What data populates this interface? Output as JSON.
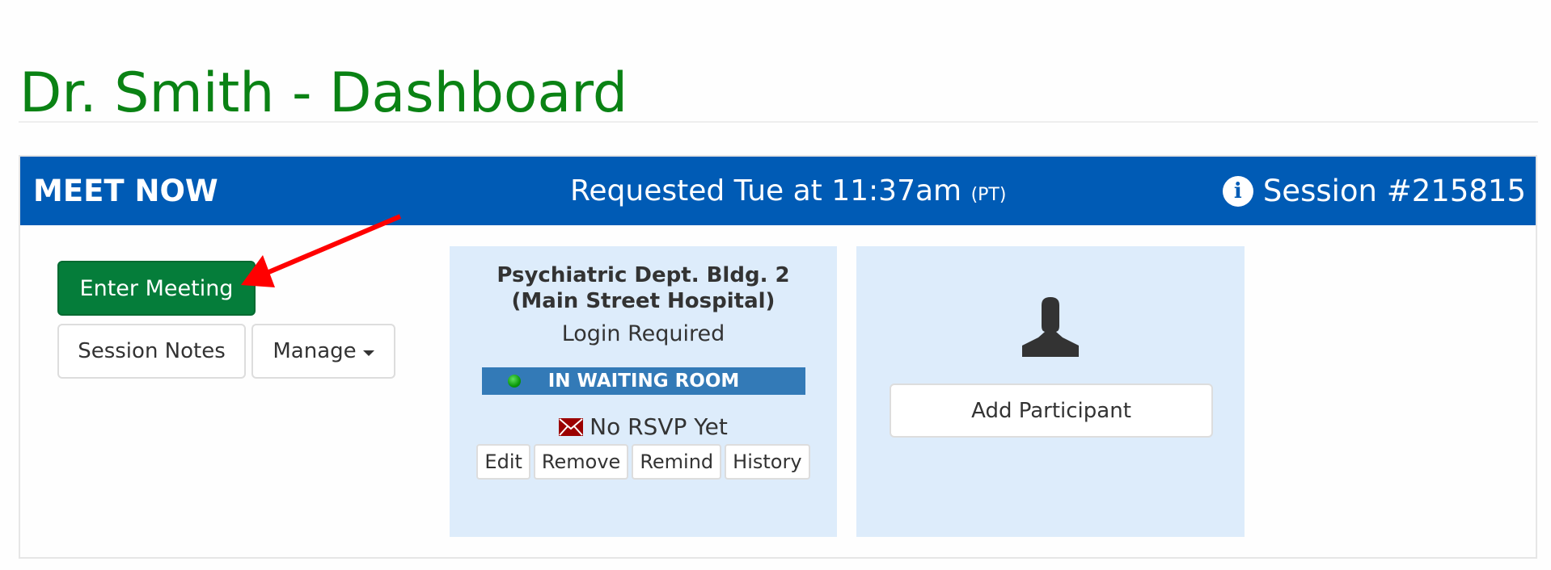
{
  "page": {
    "title": "Dr. Smith - Dashboard"
  },
  "panel": {
    "header": {
      "left_label": "MEET NOW",
      "requested_text": "Requested Tue at 11:37am",
      "timezone": "(PT)",
      "info_icon": "info-circle-icon",
      "session_label": "Session #215815"
    },
    "actions": {
      "enter_meeting": "Enter Meeting",
      "session_notes": "Session Notes",
      "manage": "Manage"
    },
    "participant_card": {
      "location": "Psychiatric Dept. Bldg. 2 (Main Street Hospital)",
      "login": "Login Required",
      "status": "IN WAITING ROOM",
      "status_color": "#337ab7",
      "status_dot_color": "#0b9a0b",
      "rsvp_icon": "envelope-icon",
      "rsvp": "No RSVP Yet",
      "buttons": [
        "Edit",
        "Remove",
        "Remind",
        "History"
      ]
    },
    "add_card": {
      "icon": "user-icon",
      "button": "Add Participant"
    }
  },
  "annotation": {
    "type": "arrow",
    "color": "#ff0000",
    "points_to": "Enter Meeting"
  },
  "colors": {
    "title": "#0a8214",
    "header_bg": "#005bb5",
    "enter_button": "#057d3a",
    "card_bg": "#ddecfb"
  }
}
